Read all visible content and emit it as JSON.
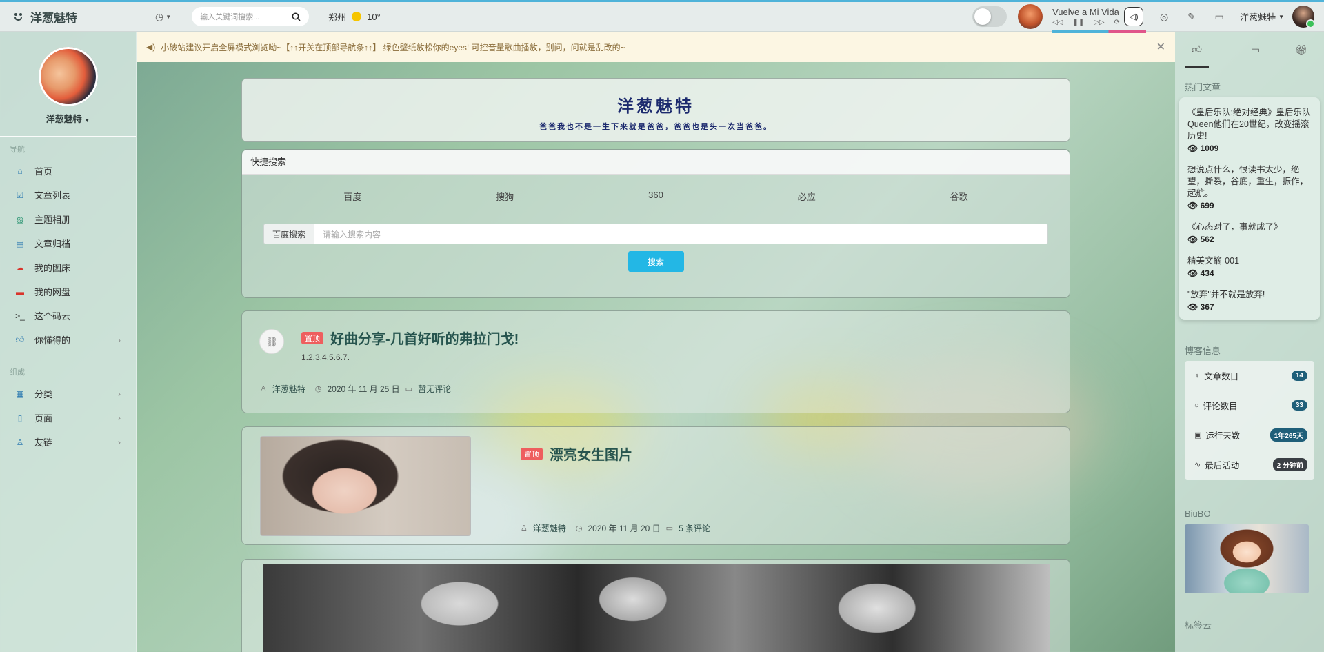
{
  "colors": {
    "accent": "#23b7e5",
    "top_tag": "#ee5e5e",
    "badge": "#1f5f79",
    "progress_a": "#4fb3d9",
    "progress_b": "#e0558a"
  },
  "topbar": {
    "brand": "洋葱魅特",
    "clock_icon": "clock-icon",
    "search_placeholder": "输入关键词搜索...",
    "city": "郑州",
    "temperature": "10°",
    "song_title": "Vuelve a Mi Vida",
    "user_name": "洋葱魅特"
  },
  "sidebar": {
    "profile_name": "洋葱魅特",
    "nav_heading": "导航",
    "nav_items": [
      {
        "label": "首页",
        "icon": "home-icon"
      },
      {
        "label": "文章列表",
        "icon": "edit-icon"
      },
      {
        "label": "主题相册",
        "icon": "image-icon"
      },
      {
        "label": "文章归档",
        "icon": "archive-icon"
      },
      {
        "label": "我的图床",
        "icon": "cloud-icon"
      },
      {
        "label": "我的网盘",
        "icon": "drive-icon"
      },
      {
        "label": "这个码云",
        "icon": "terminal-icon"
      },
      {
        "label": "你懂得的",
        "icon": "thumbs-up-icon"
      }
    ],
    "group_heading": "组成",
    "group_items": [
      {
        "label": "分类",
        "icon": "grid-icon"
      },
      {
        "label": "页面",
        "icon": "page-icon"
      },
      {
        "label": "友链",
        "icon": "user-icon"
      }
    ]
  },
  "notice": {
    "text": "小破站建议开启全屏模式浏览呦~【↑↑开关在顶部导航条↑↑】 绿色壁纸放松你的eyes! 可控音量歌曲播放，别问，问就是乱改的~"
  },
  "header": {
    "title": "洋葱魅特",
    "subtitle": "爸爸我也不是一生下来就是爸爸，爸爸也是头一次当爸爸。"
  },
  "quick_search": {
    "heading": "快捷搜索",
    "engines": [
      "百度",
      "搜狗",
      "360",
      "必应",
      "谷歌"
    ],
    "label": "百度搜索",
    "placeholder": "请输入搜索内容",
    "button": "搜索"
  },
  "posts": [
    {
      "tag": "置顶",
      "title": "好曲分享-几首好听的弗拉门戈!",
      "excerpt": "1.2.3.4.5.6.7.",
      "author": "洋葱魅特",
      "date": "2020 年 11 月 25 日",
      "comments": "暂无评论"
    },
    {
      "tag": "置顶",
      "title": "漂亮女生图片",
      "author": "洋葱魅特",
      "date": "2020 年 11 月 20 日",
      "comments": "5 条评论"
    }
  ],
  "right": {
    "hot_heading": "热门文章",
    "hot_articles": [
      {
        "title": "《皇后乐队:绝对经典》皇后乐队Queen他们在20世纪，改变摇滚历史!",
        "views": "1009"
      },
      {
        "title": "想说点什么，恨读书太少，绝望，撕裂，谷底，重生，振作，起航。",
        "views": "699"
      },
      {
        "title": "《心态对了，事就成了》",
        "views": "562"
      },
      {
        "title": "精美文摘-001",
        "views": "434"
      },
      {
        "title": "\"放弃\"并不就是放弃!",
        "views": "367"
      }
    ],
    "blog_info_heading": "博客信息",
    "blog_info": [
      {
        "label": "文章数目",
        "value": "14",
        "icon": "bulb-icon"
      },
      {
        "label": "评论数目",
        "value": "33",
        "icon": "comment-icon"
      },
      {
        "label": "运行天数",
        "value": "1年265天",
        "icon": "calendar-icon"
      },
      {
        "label": "最后活动",
        "value": "2 分钟前",
        "icon": "activity-icon"
      }
    ],
    "biubo_heading": "BiuBO",
    "tag_cloud_heading": "标签云"
  }
}
